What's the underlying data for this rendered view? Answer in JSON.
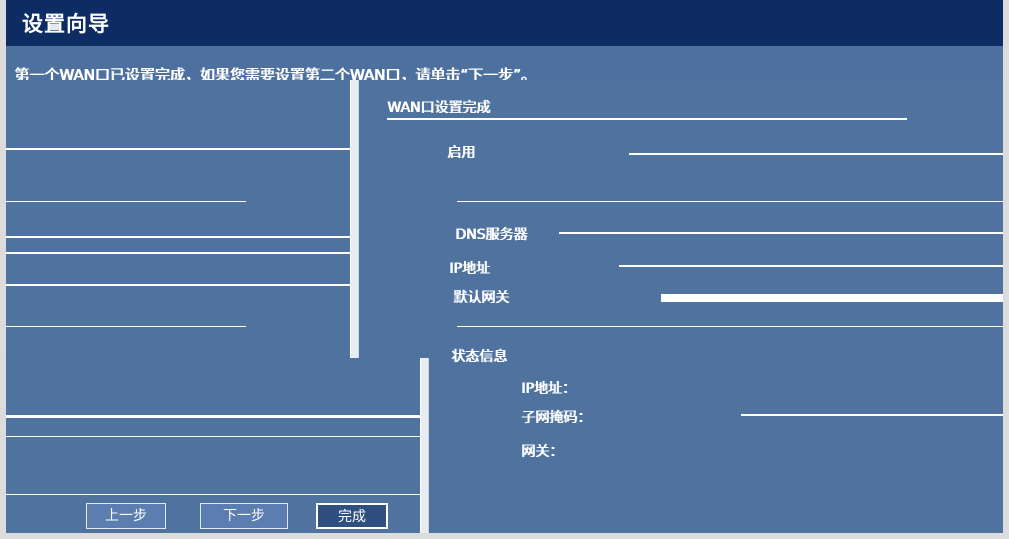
{
  "window": {
    "title": "设置向导"
  },
  "instruction": "第一个WAN口已设置完成，如果您需要设置第二个WAN口，请单击“下一步”。",
  "wan": {
    "section_label": "WAN口设置完成",
    "enabled_label": "启用",
    "dns_label": "DNS服务器",
    "ip_label": "IP地址",
    "gateway_label": "默认网关"
  },
  "status": {
    "title": "状态信息",
    "line1": "IP地址：",
    "line2": "子网掩码：",
    "line3": "网关："
  },
  "buttons": {
    "prev": "上一步",
    "next": "下一步",
    "finish": "完成"
  }
}
